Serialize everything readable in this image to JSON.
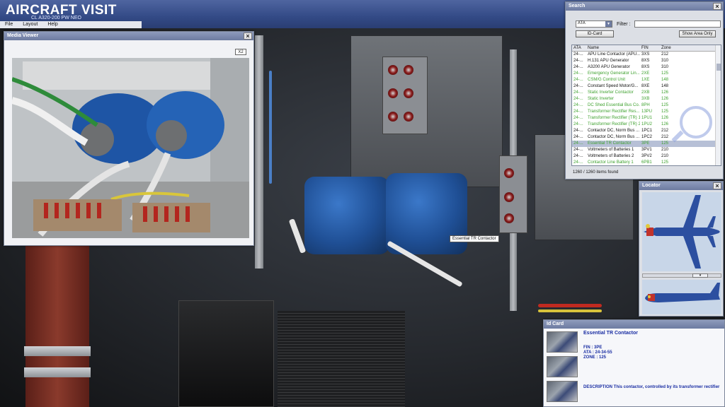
{
  "app": {
    "title": "AIRCRAFT VISIT",
    "subtitle": "CL A320-200 PW NEO"
  },
  "menu": [
    "File",
    "Layout",
    "Help"
  ],
  "media_viewer": {
    "title": "Media Viewer",
    "zoom_button": "X2",
    "close": "×",
    "photo_caption": ""
  },
  "search": {
    "title": "Search",
    "close": "×",
    "category_value": "ATA",
    "filter_label": "Filter :",
    "filter_value": "",
    "idcard_button": "ID-Card",
    "show_area_button": "Show Area Only",
    "columns": [
      "ATA",
      "Name",
      "FIN",
      "Zone"
    ],
    "rows": [
      {
        "ata": "24-...",
        "name": "APU Line Contactor (APU...",
        "fin": "3XS",
        "zone": "212",
        "green": false
      },
      {
        "ata": "24-...",
        "name": "H.131 APU Generator",
        "fin": "8XS",
        "zone": "310",
        "green": false
      },
      {
        "ata": "24-...",
        "name": "A3200 APU Generator",
        "fin": "8XS",
        "zone": "310",
        "green": false
      },
      {
        "ata": "24-...",
        "name": "Emergency Generator Lin...",
        "fin": "2XE",
        "zone": "125",
        "green": true
      },
      {
        "ata": "24-...",
        "name": "CSM/G Control Unit",
        "fin": "1XE",
        "zone": "148",
        "green": true
      },
      {
        "ata": "24-...",
        "name": "Constant Speed Motor/G...",
        "fin": "8XE",
        "zone": "148",
        "green": false
      },
      {
        "ata": "24-...",
        "name": "Static Inverter Contactor",
        "fin": "2XB",
        "zone": "126",
        "green": true
      },
      {
        "ata": "24-...",
        "name": "Static Inverter",
        "fin": "3XB",
        "zone": "126",
        "green": true
      },
      {
        "ata": "24-...",
        "name": "DC Shed Essential Bus Co...",
        "fin": "8PH",
        "zone": "125",
        "green": true
      },
      {
        "ata": "24-...",
        "name": "Transformer Rectifier Res...",
        "fin": "13PU",
        "zone": "125",
        "green": true
      },
      {
        "ata": "24-...",
        "name": "Transformer Rectifier (TR) 1",
        "fin": "1PU1",
        "zone": "126",
        "green": true
      },
      {
        "ata": "24-...",
        "name": "Transformer Rectifier (TR) 2",
        "fin": "1PU2",
        "zone": "126",
        "green": true
      },
      {
        "ata": "24-...",
        "name": "Contactor DC, Norm Bus ...",
        "fin": "1PC1",
        "zone": "212",
        "green": false
      },
      {
        "ata": "24-...",
        "name": "Contactor DC, Norm Bus ...",
        "fin": "1PC2",
        "zone": "212",
        "green": false
      },
      {
        "ata": "24-...",
        "name": "Essential TR Contactor",
        "fin": "3PE",
        "zone": "125",
        "green": true,
        "selected": true
      },
      {
        "ata": "24-...",
        "name": "Voltmeters of Batteries 1",
        "fin": "3PV1",
        "zone": "210",
        "green": false
      },
      {
        "ata": "24-...",
        "name": "Voltmeters of Batteries 2",
        "fin": "3PV2",
        "zone": "210",
        "green": false
      },
      {
        "ata": "24-...",
        "name": "Contactor Line Battery 1",
        "fin": "6PB1",
        "zone": "125",
        "green": true
      }
    ],
    "items_found": "1260 / 1260 items found"
  },
  "locator": {
    "title": "Locator",
    "close": "×"
  },
  "idcard": {
    "title": "Id Card",
    "name": "Essential TR Contactor",
    "fin": "FIN : 3PE",
    "ata": "ATA : 24-34-55",
    "zone": "ZONE : 125",
    "description": "DESCRIPTION This contactor, controlled by its transformer rectifier"
  },
  "tooltip": "Essential TR Contactor",
  "colors": {
    "title_bar": "#334a86",
    "green_item": "#3ea12e",
    "idcard_text": "#1a2ea3"
  }
}
